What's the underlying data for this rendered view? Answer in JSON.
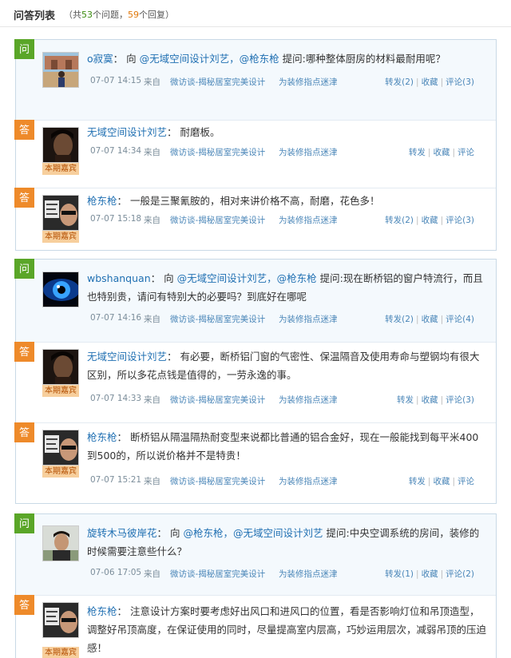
{
  "header": {
    "title": "问答列表",
    "count_prefix": "（共",
    "question_count": "53",
    "count_mid": "个问题，",
    "reply_count": "59",
    "count_suffix": "个回复）"
  },
  "labels": {
    "question_badge": "问",
    "answer_badge": "答",
    "guest_tag": "本期嘉宾",
    "from": "来自",
    "source1": "微访谈-揭秘居室完美设计",
    "source2": "为装修指点迷津",
    "favorite": "收藏",
    "colon": "：",
    "ask_prefix": "向",
    "ask_label": "提问:"
  },
  "threads": [
    {
      "question": {
        "user": "o寂寞",
        "mentions": [
          "@无域空间设计刘艺，",
          "@枪东枪"
        ],
        "text": "哪种整体厨房的材料最耐用呢？",
        "time": "07-07 14:15",
        "repost": "转发(2)",
        "comment": "评论(3)"
      },
      "answers": [
        {
          "user": "无域空间设计刘艺",
          "text": "耐磨板。",
          "time": "07-07 14:34",
          "repost": "转发",
          "comment": "评论"
        },
        {
          "user": "枪东枪",
          "text": "一般是三聚氰胺的，相对来讲价格不高，耐磨，花色多！",
          "time": "07-07 15:18",
          "repost": "转发(2)",
          "comment": "评论(3)"
        }
      ]
    },
    {
      "question": {
        "user": "wbshanquan",
        "mentions": [
          "@无域空间设计刘艺，",
          "@枪东枪"
        ],
        "text": "现在断桥铝的窗户特流行，而且也特别贵，请问有特别大的必要吗？到底好在哪呢",
        "time": "07-07 14:16",
        "repost": "转发(2)",
        "comment": "评论(4)"
      },
      "answers": [
        {
          "user": "无域空间设计刘艺",
          "text": "有必要，断桥铝门窗的气密性、保温隔音及使用寿命与塑钢均有很大区别，所以多花点钱是值得的，一劳永逸的事。",
          "time": "07-07 14:33",
          "repost": "转发",
          "comment": "评论(3)"
        },
        {
          "user": "枪东枪",
          "text": "断桥铝从隔温隔热耐变型来说都比普通的铝合金好，现在一般能找到每平米400到500的，所以说价格并不是特贵！",
          "time": "07-07 15:21",
          "repost": "转发",
          "comment": "评论"
        }
      ]
    },
    {
      "question": {
        "user": "旋转木马彼岸花",
        "mentions": [
          "@枪东枪，",
          "@无域空间设计刘艺"
        ],
        "text": "中央空调系统的房间，装修的时候需要注意些什么？",
        "time": "07-06 17:05",
        "repost": "转发(1)",
        "comment": "评论(2)"
      },
      "answers": [
        {
          "user": "枪东枪",
          "text": "注意设计方案时要考虑好出风口和进风口的位置，看是否影响灯位和吊顶造型，调整好吊顶高度，在保证使用的同时，尽量提高室内层高，巧妙运用层次，减弱吊顶的压迫感！"
        }
      ]
    }
  ],
  "colors": {
    "question_badge": "#5aa628",
    "answer_badge": "#ee8a2a",
    "link": "#1f6fb2",
    "border": "#c9d9e6",
    "guest_tag_bg": "#f7cf9d"
  }
}
